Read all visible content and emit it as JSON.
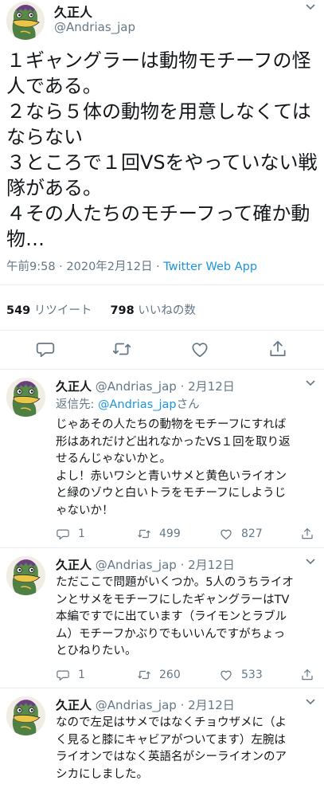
{
  "main_tweet": {
    "name": "久正人",
    "handle": "@Andrias_jap",
    "body_lines": [
      "１ギャングラーは動物モチーフの怪",
      "人である。",
      "２なら５体の動物を用意しなくては",
      "ならない",
      "３ところで１回VSをやっていない戦",
      "隊がある。",
      "４その人たちのモチーフって確か動",
      "物…"
    ],
    "time": "午前9:58",
    "date": "2020年2月12日",
    "sep": "·",
    "source": "Twitter Web App",
    "retweets_count": "549",
    "retweets_label": "リツイート",
    "likes_count": "798",
    "likes_label": "いいねの数"
  },
  "replies": [
    {
      "name": "久正人",
      "handle": "@Andrias_jap",
      "date": "· 2月12日",
      "reply_to_prefix": "返信先: ",
      "reply_to_handle": "@Andrias_jap",
      "reply_to_suffix": "さん",
      "body_lines": [
        "じゃあその人たちの動物をモチーフにすれば",
        "形はあれだけど出れなかったVS１回を取り返",
        "せるんじゃないかと。",
        "よし！赤いワシと青いサメと黄色いライオン",
        "と緑のゾウと白いトラをモチーフにしようじ",
        "ゃないか！"
      ],
      "replies_count": "1",
      "retweets_count": "499",
      "likes_count": "827"
    },
    {
      "name": "久正人",
      "handle": "@Andrias_jap",
      "date": "· 2月12日",
      "body_lines": [
        "ただここで問題がいくつか。5人のうちライオ",
        "ンとサメをモチーフにしたギャングラーはTV",
        "本編ですでに出ています（ライモンとラブル",
        "ム）モチーフかぶりでもいいんですがちょっ",
        "とひねりたい。"
      ],
      "replies_count": "1",
      "retweets_count": "260",
      "likes_count": "533"
    },
    {
      "name": "久正人",
      "handle": "@Andrias_jap",
      "date": "· 2月12日",
      "body_lines": [
        "なので左足はサメではなくチョウザメに（よ",
        "く見ると膝にキャビアがついてます）左腕は",
        "ライオンではなく英語名がシーライオンのア",
        "シカにしました。"
      ]
    }
  ],
  "icons": {
    "reply": "reply-icon",
    "retweet": "retweet-icon",
    "like": "heart-icon",
    "share": "share-icon",
    "caret": "chevron-down-icon",
    "avatar": "frog-avatar"
  },
  "colors": {
    "link": "#1b95e0",
    "secondary_text": "#657786",
    "divider": "#e6ecf0"
  }
}
